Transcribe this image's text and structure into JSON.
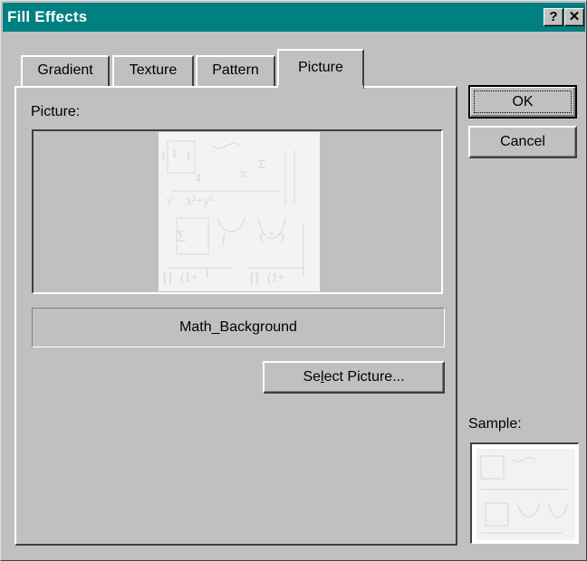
{
  "window": {
    "title": "Fill Effects"
  },
  "titlebar": {
    "help_glyph": "?",
    "close_glyph": "✕"
  },
  "tabs": [
    {
      "label": "Gradient"
    },
    {
      "label": "Texture"
    },
    {
      "label": "Pattern"
    },
    {
      "label": "Picture",
      "selected": true
    }
  ],
  "picture": {
    "label": "Picture:",
    "name": "Math_Background",
    "select_prefix": "Se",
    "select_underlined": "l",
    "select_suffix": "ect Picture..."
  },
  "buttons": {
    "ok": "OK",
    "cancel": "Cancel"
  },
  "sample": {
    "label": "Sample:"
  }
}
